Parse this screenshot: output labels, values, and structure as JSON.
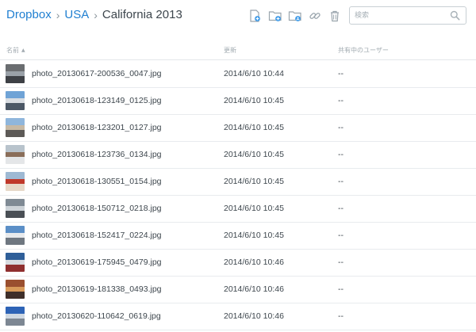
{
  "breadcrumb": {
    "items": [
      {
        "label": "Dropbox"
      },
      {
        "label": "USA"
      }
    ],
    "separator": "›",
    "current": "California 2013"
  },
  "toolbar": {
    "icons": [
      "upload-file-icon",
      "new-folder-icon",
      "shared-folder-icon",
      "share-link-icon",
      "delete-icon"
    ]
  },
  "search": {
    "placeholder": "検索",
    "value": ""
  },
  "columns": {
    "name": "名前",
    "modified": "更新",
    "shared": "共有中のユーザー"
  },
  "colors": {
    "link": "#1f7fd1",
    "text": "#3d464d",
    "muted": "#a2abb1",
    "divider": "#e8ebee"
  },
  "files": [
    {
      "name": "photo_20130617-200536_0047.jpg",
      "modified": "2014/6/10 10:44",
      "shared": "--",
      "thumb_colors": [
        "#6a6d70",
        "#9aa1a8",
        "#3e4146"
      ]
    },
    {
      "name": "photo_20130618-123149_0125.jpg",
      "modified": "2014/6/10 10:45",
      "shared": "--",
      "thumb_colors": [
        "#6fa3d6",
        "#d9dde2",
        "#4c5866"
      ]
    },
    {
      "name": "photo_20130618-123201_0127.jpg",
      "modified": "2014/6/10 10:45",
      "shared": "--",
      "thumb_colors": [
        "#8fb6dc",
        "#c7b9a4",
        "#5d5a57"
      ]
    },
    {
      "name": "photo_20130618-123736_0134.jpg",
      "modified": "2014/6/10 10:45",
      "shared": "--",
      "thumb_colors": [
        "#b8c3cc",
        "#8a6e5a",
        "#e4e6e8"
      ]
    },
    {
      "name": "photo_20130618-130551_0154.jpg",
      "modified": "2014/6/10 10:45",
      "shared": "--",
      "thumb_colors": [
        "#9eb9d3",
        "#c0392b",
        "#e7d9c9"
      ]
    },
    {
      "name": "photo_20130618-150712_0218.jpg",
      "modified": "2014/6/10 10:45",
      "shared": "--",
      "thumb_colors": [
        "#7f8a94",
        "#cdd3d8",
        "#4a4f55"
      ]
    },
    {
      "name": "photo_20130618-152417_0224.jpg",
      "modified": "2014/6/10 10:45",
      "shared": "--",
      "thumb_colors": [
        "#5b8fc7",
        "#e8eaec",
        "#6f7780"
      ]
    },
    {
      "name": "photo_20130619-175945_0479.jpg",
      "modified": "2014/6/10 10:46",
      "shared": "--",
      "thumb_colors": [
        "#2f5f99",
        "#d7dbe0",
        "#8f2f2f"
      ]
    },
    {
      "name": "photo_20130619-181338_0493.jpg",
      "modified": "2014/6/10 10:46",
      "shared": "--",
      "thumb_colors": [
        "#9a4f2f",
        "#d89a5a",
        "#3f2f2a"
      ]
    },
    {
      "name": "photo_20130620-110642_0619.jpg",
      "modified": "2014/6/10 10:46",
      "shared": "--",
      "thumb_colors": [
        "#2d63b6",
        "#cfd8e2",
        "#7d8793"
      ]
    }
  ]
}
